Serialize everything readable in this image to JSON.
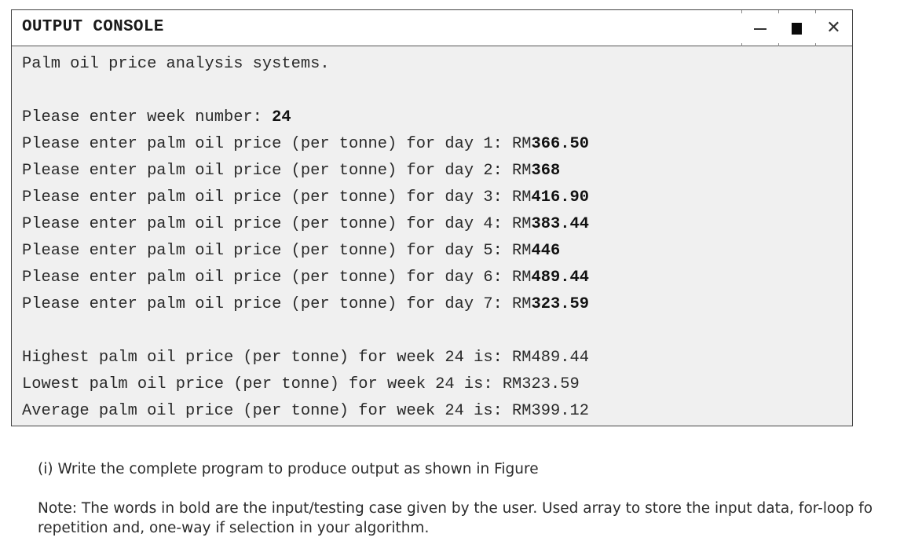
{
  "window": {
    "title": "OUTPUT CONSOLE",
    "controls": {
      "minimize": "minimize",
      "maximize": "maximize",
      "close": "✕"
    }
  },
  "console": {
    "header": "Palm oil price analysis systems.",
    "week_prompt": "Please enter week number: ",
    "week_input": "24",
    "price_prompts": [
      {
        "prompt": "Please enter palm oil price (per tonne) for day 1: RM",
        "input": "366.50"
      },
      {
        "prompt": "Please enter palm oil price (per tonne) for day 2: RM",
        "input": "368"
      },
      {
        "prompt": "Please enter palm oil price (per tonne) for day 3: RM",
        "input": "416.90"
      },
      {
        "prompt": "Please enter palm oil price (per tonne) for day 4: RM",
        "input": "383.44"
      },
      {
        "prompt": "Please enter palm oil price (per tonne) for day 5: RM",
        "input": "446"
      },
      {
        "prompt": "Please enter palm oil price (per tonne) for day 6: RM",
        "input": "489.44"
      },
      {
        "prompt": "Please enter palm oil price (per tonne) for day 7: RM",
        "input": "323.59"
      }
    ],
    "results": [
      "Highest palm oil price (per tonne) for week 24 is: RM489.44",
      "Lowest palm oil price (per tonne) for week 24 is: RM323.59",
      "Average palm oil price (per tonne) for week 24 is: RM399.12"
    ]
  },
  "question": {
    "part_i": "(i) Write the complete program to produce output as shown in Figure",
    "note_line1": "Note: The words in bold are the input/testing case given by the user. Used array to store the input data, for-loop fo",
    "note_line2": "repetition and, one-way if selection in your algorithm."
  }
}
